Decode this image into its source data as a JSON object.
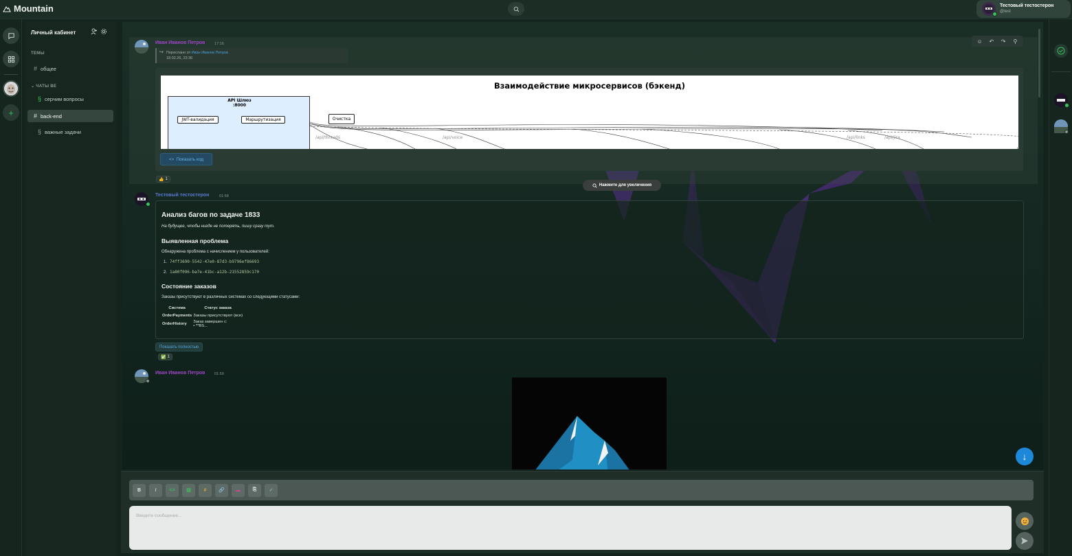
{
  "app": {
    "title": "Mountain"
  },
  "header": {
    "user": {
      "name": "Тестовый тестостерон",
      "handle": "@test"
    }
  },
  "sidebar": {
    "title": "Личный кабинет",
    "topics_label": "ТЕМЫ",
    "topics": [
      {
        "label": "общее"
      }
    ],
    "chats_label": "ЧАТЫ ВЕ",
    "chats": [
      {
        "label": "серчим вопросы"
      },
      {
        "label": "back-end"
      },
      {
        "label": "важные задачи"
      }
    ]
  },
  "messages": [
    {
      "author": "Иван Иванов Петров",
      "time": "17:16",
      "forwarded_prefix": "Переслано от",
      "forwarded_from": "Иван Иванов Петров",
      "forwarded_date": "18.02.26, 23:36",
      "diagram": {
        "title": "Взаимодействие микросервисов (бэкенд)",
        "gateway_title": "API Шлюз",
        "gateway_port": ":8000",
        "nodes": [
          "JWT-валидация",
          "Маршрутизация",
          "Очистка"
        ],
        "edge_labels": [
          "/api/threads",
          "/api/voice",
          "/api/links",
          "/api/jira"
        ],
        "zoom_hint": "Нажмите для увеличения"
      },
      "show_code": "Показать код",
      "reaction": {
        "emoji": "👍",
        "count": "1"
      }
    },
    {
      "author": "Тестовый тестостерон",
      "time": "01:58",
      "h1": "Анализ багов по задаче 1833",
      "italic": "На будущее, чтобы нигде не потерять, пишу сразу тут.",
      "h2_problem": "Выявленная проблема",
      "problem_text": "Обнаружена проблема с начислением у пользователей:",
      "ids": [
        "74ff3690-5542-47e0-87d3-b9796ef86693",
        "1a80f096-ba7e-41bc-a12b-21552859c170"
      ],
      "h2_orders": "Состояние заказов",
      "orders_text": "Заказы присутствуют в различных системах со следующими статусами:",
      "table": {
        "headers": [
          "Система",
          "Статус заказа"
        ],
        "rows": [
          [
            "OrderPayments",
            "Заказы присутствуют (все)"
          ],
          [
            "OrderHistory",
            "Заказ завершен с:",
            "• **BS..."
          ]
        ]
      },
      "show_all": "Показать полностью",
      "reaction": {
        "emoji": "✅",
        "count": "1"
      }
    },
    {
      "author": "Иван Иванов Петров",
      "time": "01:59"
    }
  ],
  "composer": {
    "placeholder": "Введите сообщение...",
    "tools": [
      "B",
      "I",
      "<>",
      "list",
      "#",
      "link",
      "quote",
      "clipboard",
      "check"
    ]
  },
  "colors": {
    "accent": "#1e88d8",
    "author": "#a046c8",
    "online": "#3bbf5a"
  }
}
